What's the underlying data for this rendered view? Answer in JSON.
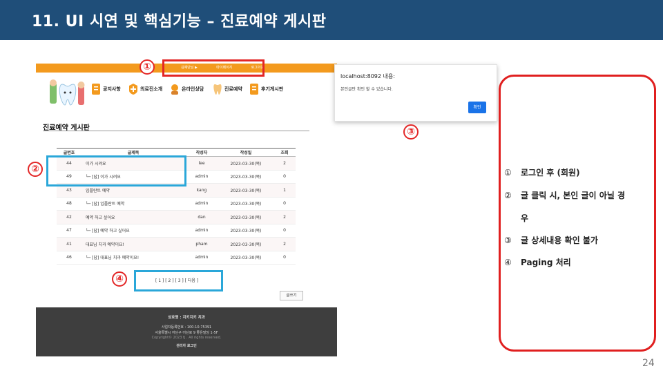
{
  "slide": {
    "title": "11. UI 시연 및 핵심기능 – 진료예약 게시판",
    "page_number": "24"
  },
  "site": {
    "top_links": [
      "김예단님 ▶",
      "마이페이지",
      "로그아웃"
    ],
    "menu": [
      "공지사항",
      "의료진소개",
      "온라인상담",
      "진료예약",
      "후기게시판"
    ],
    "board_title": "진료예약 게시판",
    "columns": [
      "글번호",
      "글제목",
      "작성자",
      "작성일",
      "조회"
    ],
    "rows": [
      {
        "no": "44",
        "title": "이가 시려요",
        "author": "lee",
        "date": "2023-03-30(목)",
        "views": "2"
      },
      {
        "no": "49",
        "title": "└─ [답] 이가 시려요",
        "author": "admin",
        "date": "2023-03-30(목)",
        "views": "0"
      },
      {
        "no": "43",
        "title": "임플란트 예약",
        "author": "kang",
        "date": "2023-03-30(목)",
        "views": "1"
      },
      {
        "no": "48",
        "title": "└─ [답] 임플란트 예약",
        "author": "admin",
        "date": "2023-03-30(목)",
        "views": "0"
      },
      {
        "no": "42",
        "title": "예약 하고 싶어요",
        "author": "dan",
        "date": "2023-03-30(목)",
        "views": "2"
      },
      {
        "no": "47",
        "title": "└─ [답] 예약 하고 싶어요",
        "author": "admin",
        "date": "2023-03-30(목)",
        "views": "0"
      },
      {
        "no": "41",
        "title": "대표님 치과 예약이요!",
        "author": "pham",
        "date": "2023-03-30(목)",
        "views": "2"
      },
      {
        "no": "46",
        "title": "└─ [답] 대표님 치과 예약이요!",
        "author": "admin",
        "date": "2023-03-30(목)",
        "views": "0"
      }
    ],
    "paging": "[ 1 ] [ 2 ] [ 3 ] [ 다음 ]",
    "write_button": "글쓰기",
    "footer": {
      "name": "상호명 : 지키지키 치과",
      "biz_no": "사업자등록번호 : 100-10-75391",
      "address": "서울특별시 어딘구 어딘로 9 좋은빌딩 1-5F",
      "copyright": "Copyright© 2023 tj . All rights reserved.",
      "admin_login": "관리자 로그인"
    }
  },
  "dialog": {
    "title": "localhost:8092 내용:",
    "message": "본인글만 확인 할 수 있습니다.",
    "ok_button": "확인"
  },
  "markers": [
    "①",
    "②",
    "③",
    "④"
  ],
  "description": {
    "items": [
      {
        "num": "①",
        "text": "로그인 후 (회원)"
      },
      {
        "num": "②",
        "text": "글 클릭 시, 본인 글이 아닐 경"
      },
      {
        "num": "",
        "text": "우"
      },
      {
        "num": "③",
        "text": "글 상세내용 확인 불가"
      },
      {
        "num": "④",
        "text": "Paging 처리"
      }
    ]
  },
  "colors": {
    "title_bar": "#1f4e79",
    "site_orange": "#f39a1e",
    "annotation_red": "#e32626",
    "annotation_blue": "#2aa7d9",
    "dialog_button": "#1a73e8",
    "footer": "#3e3e3e"
  }
}
